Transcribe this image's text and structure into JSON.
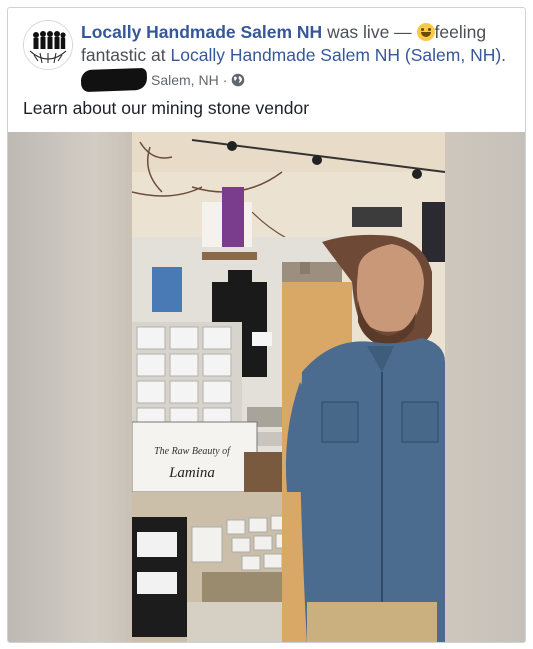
{
  "post": {
    "page_name": "Locally Handmade Salem NH",
    "live_text": " was live — ",
    "feeling_text": "feeling fantastic at ",
    "location_name": "Locally Handmade Salem NH (Salem, NH)",
    "location_end": ".",
    "meta_location": "Salem, NH",
    "meta_sep": "·",
    "message": "Learn about our mining stone vendor"
  },
  "video": {
    "sign_line1": "The Raw Beauty of",
    "sign_line2": "Lamina"
  },
  "icons": [
    "avatar-logo",
    "feeling-emoji-icon",
    "globe-icon"
  ],
  "colors": {
    "link": "#365899",
    "text": "#1d2129",
    "meta": "#616770"
  }
}
